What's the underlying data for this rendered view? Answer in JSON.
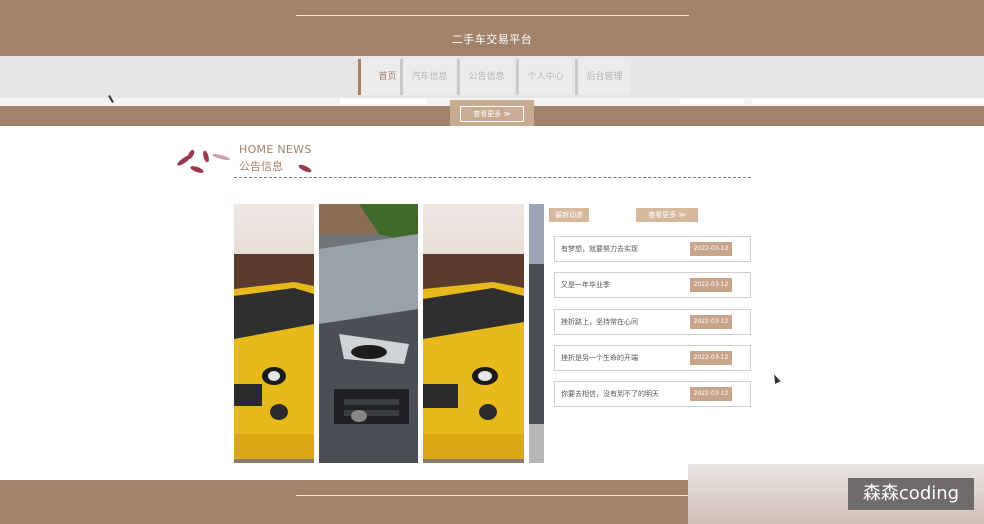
{
  "header": {
    "title": "二手车交易平台"
  },
  "nav": {
    "items": [
      {
        "label": "首页",
        "active": true
      },
      {
        "label": "汽车信息",
        "active": false
      },
      {
        "label": "公告信息",
        "active": false
      },
      {
        "label": "个人中心",
        "active": false
      },
      {
        "label": "后台管理",
        "active": false
      }
    ]
  },
  "banner": {
    "more_label": "查看更多 ≫"
  },
  "section": {
    "title_en": "HOME NEWS",
    "title_cn": "公告信息"
  },
  "news": {
    "latest_label": "最新动态",
    "more_label": "查看更多 ≫",
    "items": [
      {
        "title": "有梦想，就要努力去实现",
        "date": "2022-03-12"
      },
      {
        "title": "又是一年毕业季",
        "date": "2022-03-12"
      },
      {
        "title": "挫折路上，坚持常在心间",
        "date": "2022-03-12"
      },
      {
        "title": "挫折是另一个生命的开端",
        "date": "2022-03-12"
      },
      {
        "title": "你要去相信，没有到不了的明天",
        "date": "2022-03-12"
      }
    ]
  },
  "watermark": "森森coding",
  "colors": {
    "accent": "#a3826a",
    "nav_bg": "#e6e6e6",
    "date_badge": "#c8a58a"
  }
}
